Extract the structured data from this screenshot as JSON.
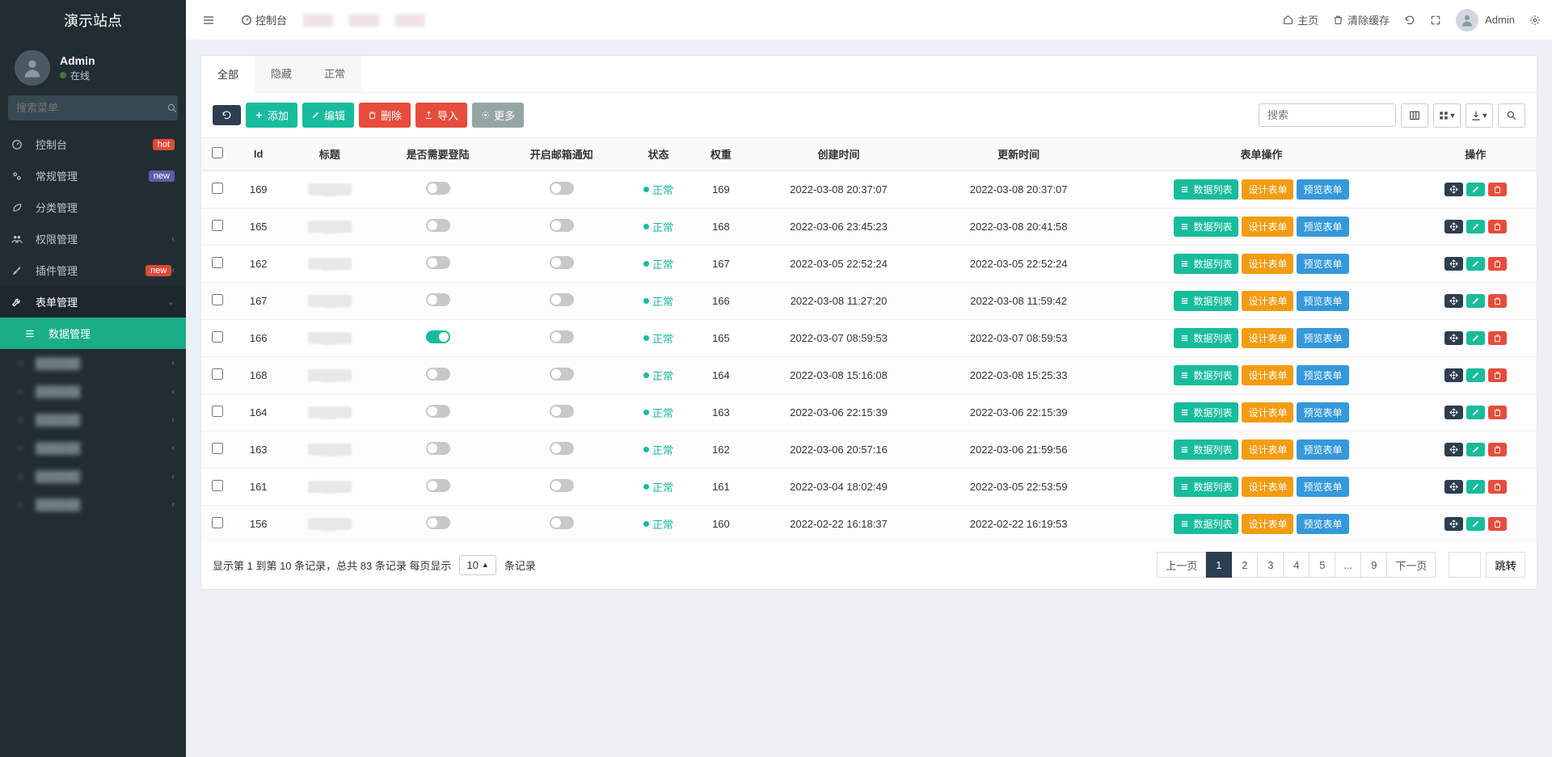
{
  "brand": "演示站点",
  "user": {
    "name": "Admin",
    "status": "在线"
  },
  "search_placeholder": "搜索菜单",
  "sidebar": {
    "items": [
      {
        "icon": "dashboard",
        "label": "控制台",
        "badge": "hot",
        "badge_class": "badge-hot"
      },
      {
        "icon": "cogs",
        "label": "常规管理",
        "badge": "new",
        "badge_class": "badge-new"
      },
      {
        "icon": "leaf",
        "label": "分类管理"
      },
      {
        "icon": "group",
        "label": "权限管理",
        "arrow": true
      },
      {
        "icon": "rocket",
        "label": "插件管理",
        "badge": "new",
        "badge_class": "badge-hot",
        "arrow": true
      },
      {
        "icon": "wrench",
        "label": "表单管理",
        "arrow": true,
        "open": true
      }
    ],
    "sub_active": "数据管理",
    "blurred_items": 6
  },
  "header": {
    "crumb_root": "控制台",
    "home": "主页",
    "clear_cache": "清除缓存",
    "user": "Admin"
  },
  "tabs": [
    {
      "label": "全部",
      "active": true
    },
    {
      "label": "隐藏"
    },
    {
      "label": "正常"
    }
  ],
  "toolbar": {
    "refresh": "",
    "add": "添加",
    "edit": "编辑",
    "delete": "删除",
    "import": "导入",
    "more": "更多",
    "search_placeholder": "搜索"
  },
  "columns": [
    "",
    "Id",
    "标题",
    "是否需要登陆",
    "开启邮箱通知",
    "状态",
    "权重",
    "创建时间",
    "更新时间",
    "表单操作",
    "操作"
  ],
  "status_label": "正常",
  "form_ops": {
    "data_list": "数据列表",
    "design": "设计表单",
    "preview": "预览表单"
  },
  "rows": [
    {
      "id": 169,
      "login": false,
      "email": false,
      "weight": 169,
      "created": "2022-03-08 20:37:07",
      "updated": "2022-03-08 20:37:07"
    },
    {
      "id": 165,
      "login": false,
      "email": false,
      "weight": 168,
      "created": "2022-03-06 23:45:23",
      "updated": "2022-03-08 20:41:58"
    },
    {
      "id": 162,
      "login": false,
      "email": false,
      "weight": 167,
      "created": "2022-03-05 22:52:24",
      "updated": "2022-03-05 22:52:24"
    },
    {
      "id": 167,
      "login": false,
      "email": false,
      "weight": 166,
      "created": "2022-03-08 11:27:20",
      "updated": "2022-03-08 11:59:42"
    },
    {
      "id": 166,
      "login": true,
      "email": false,
      "weight": 165,
      "created": "2022-03-07 08:59:53",
      "updated": "2022-03-07 08:59:53"
    },
    {
      "id": 168,
      "login": false,
      "email": false,
      "weight": 164,
      "created": "2022-03-08 15:16:08",
      "updated": "2022-03-08 15:25:33"
    },
    {
      "id": 164,
      "login": false,
      "email": false,
      "weight": 163,
      "created": "2022-03-06 22:15:39",
      "updated": "2022-03-06 22:15:39"
    },
    {
      "id": 163,
      "login": false,
      "email": false,
      "weight": 162,
      "created": "2022-03-06 20:57:16",
      "updated": "2022-03-06 21:59:56"
    },
    {
      "id": 161,
      "login": false,
      "email": false,
      "weight": 161,
      "created": "2022-03-04 18:02:49",
      "updated": "2022-03-05 22:53:59"
    },
    {
      "id": 156,
      "login": false,
      "email": false,
      "weight": 160,
      "created": "2022-02-22 16:18:37",
      "updated": "2022-02-22 16:19:53"
    }
  ],
  "footer": {
    "info": "显示第 1 到第 10 条记录，总共 83 条记录 每页显示",
    "page_size": "10",
    "info_suffix": "条记录",
    "prev": "上一页",
    "next": "下一页",
    "pages": [
      "1",
      "2",
      "3",
      "4",
      "5",
      "...",
      "9"
    ],
    "active_page": "1",
    "jump": "跳转"
  }
}
